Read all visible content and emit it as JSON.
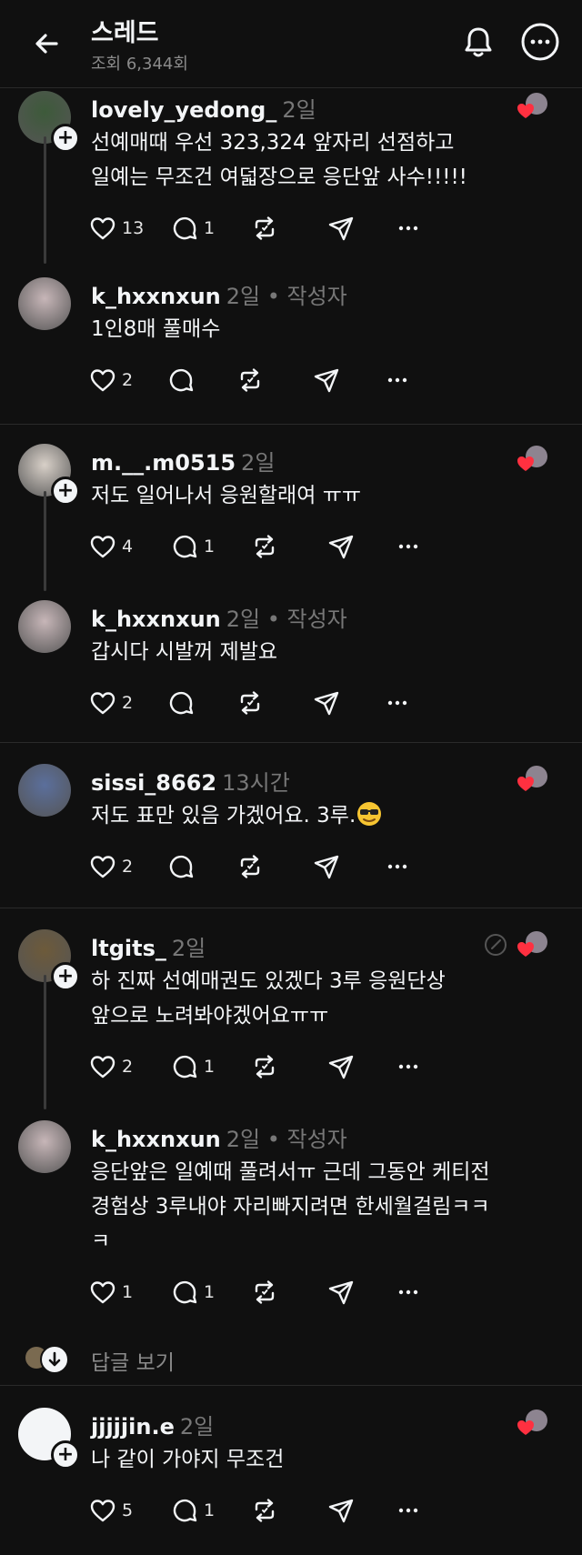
{
  "header": {
    "title": "스레드",
    "views": "조회 6,344회"
  },
  "posts": [
    {
      "user": "lovely_yedong_",
      "time": "2일",
      "author": "",
      "lines": [
        "선예매때 우선 323,324 앞자리 선점하고",
        "일예는 무조건 여덟장으로 응단앞 사수!!!!!"
      ],
      "likes": "13",
      "replies": "1"
    },
    {
      "user": "k_hxxnxun",
      "time": "2일",
      "author": " • 작성자",
      "lines": [
        "1인8매 풀매수"
      ],
      "likes": "2",
      "replies": ""
    },
    {
      "user": "m.__.m0515",
      "time": "2일",
      "author": "",
      "lines": [
        "저도 일어나서 응원할래여 ㅠㅠ"
      ],
      "likes": "4",
      "replies": "1"
    },
    {
      "user": "k_hxxnxun",
      "time": "2일",
      "author": " • 작성자",
      "lines": [
        "갑시다 시발꺼 제발요"
      ],
      "likes": "2",
      "replies": ""
    },
    {
      "user": "sissi_8662",
      "time": "13시간",
      "author": "",
      "lines": [
        "저도 표만 있음 가겠어요. 3루."
      ],
      "likes": "2",
      "replies": ""
    },
    {
      "user": "ltgits_",
      "time": "2일",
      "author": "",
      "lines": [
        "하 진짜 선예매권도 있겠다 3루 응원단상",
        "앞으로 노려봐야겠어요ㅠㅠ"
      ],
      "likes": "2",
      "replies": "1"
    },
    {
      "user": "k_hxxnxun",
      "time": "2일",
      "author": " • 작성자",
      "lines": [
        "응단앞은 일예때 풀려서ㅠ 근데 그동안 케티전",
        "경험상 3루내야 자리빠지려면 한세월걸림ㅋㅋ",
        "ㅋ"
      ],
      "likes": "1",
      "replies": "1"
    },
    {
      "user": "jjjjjin.e",
      "time": "2일",
      "author": "",
      "lines": [
        "나 같이 가야지 무조건"
      ],
      "likes": "5",
      "replies": "1"
    }
  ],
  "view_replies": "답글 보기",
  "colors": {
    "background": "#101010",
    "text": "#f3f5f7",
    "muted": "#777777",
    "heart": "#ff3040"
  }
}
